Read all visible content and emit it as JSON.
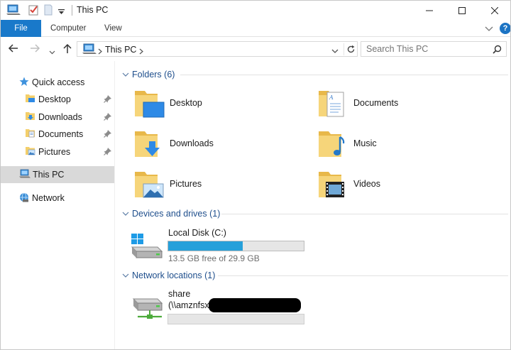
{
  "window": {
    "title": "This PC"
  },
  "ribbon": {
    "tabs": [
      {
        "label": "File",
        "active": true
      },
      {
        "label": "Computer",
        "active": false
      },
      {
        "label": "View",
        "active": false
      }
    ],
    "help_label": "?"
  },
  "address": {
    "path": "This PC",
    "search_placeholder": "Search This PC"
  },
  "navigation_pane": {
    "quick_access": {
      "label": "Quick access",
      "icon": "star-icon"
    },
    "pinned": [
      {
        "label": "Desktop",
        "icon": "desktop-folder-icon",
        "pinned": true
      },
      {
        "label": "Downloads",
        "icon": "downloads-folder-icon",
        "pinned": true
      },
      {
        "label": "Documents",
        "icon": "documents-folder-icon",
        "pinned": true
      },
      {
        "label": "Pictures",
        "icon": "pictures-folder-icon",
        "pinned": true
      }
    ],
    "this_pc": {
      "label": "This PC",
      "icon": "computer-icon",
      "selected": true
    },
    "network": {
      "label": "Network",
      "icon": "network-icon"
    }
  },
  "content": {
    "folders_group": {
      "label": "Folders (6)"
    },
    "folders": [
      {
        "label": "Desktop",
        "icon": "desktop-folder-icon"
      },
      {
        "label": "Documents",
        "icon": "documents-folder-icon"
      },
      {
        "label": "Downloads",
        "icon": "downloads-folder-icon"
      },
      {
        "label": "Music",
        "icon": "music-folder-icon"
      },
      {
        "label": "Pictures",
        "icon": "pictures-folder-icon"
      },
      {
        "label": "Videos",
        "icon": "videos-folder-icon"
      }
    ],
    "devices_group": {
      "label": "Devices and drives (1)"
    },
    "drive": {
      "name": "Local Disk (C:)",
      "free_text": "13.5 GB free of 29.9 GB",
      "used_fraction": 0.55,
      "bar_color": "#26a0da"
    },
    "network_group": {
      "label": "Network locations (1)"
    },
    "network_location": {
      "name": "share",
      "path_prefix": "(\\\\amznfsx"
    }
  },
  "colors": {
    "accent": "#1979ca",
    "group_header": "#1e4e8c",
    "selection": "#d9d9d9",
    "folder": "#f4cf6a"
  }
}
